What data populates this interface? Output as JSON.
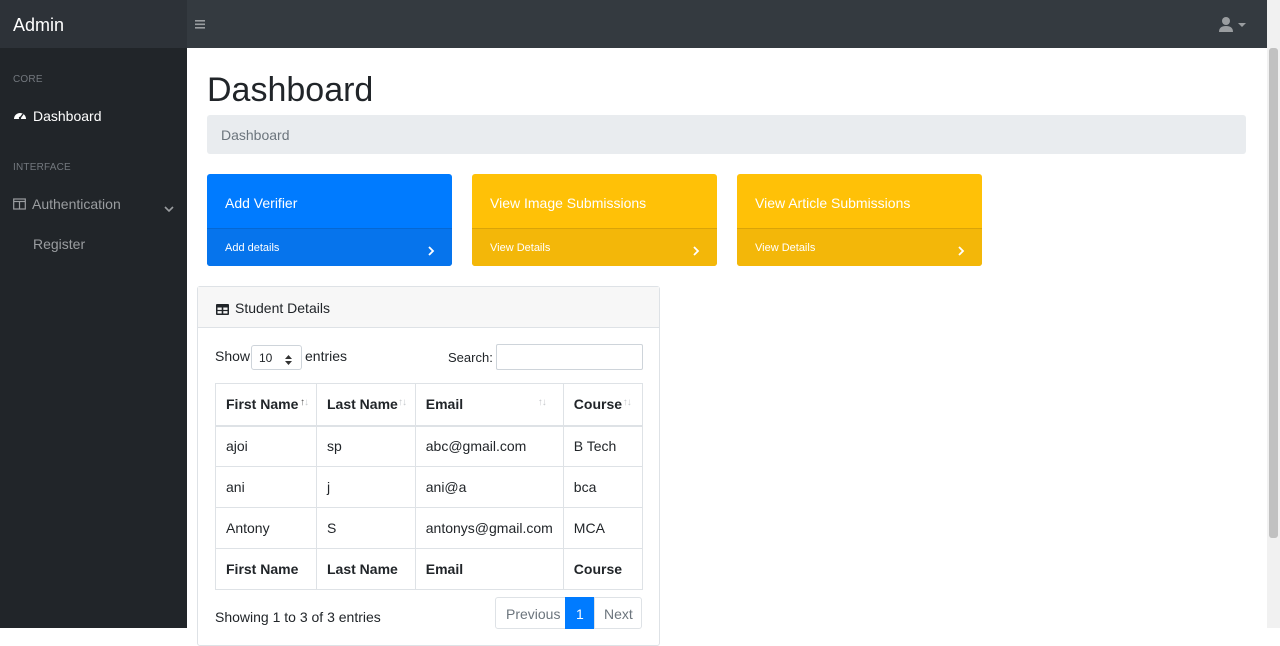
{
  "topnav": {
    "brand": "Admin"
  },
  "sidebar": {
    "heading_core": "CORE",
    "dashboard_label": "Dashboard",
    "heading_interface": "INTERFACE",
    "authentication_label": "Authentication",
    "register_label": "Register"
  },
  "main": {
    "title": "Dashboard",
    "breadcrumb": "Dashboard"
  },
  "cards": [
    {
      "title": "Add Verifier",
      "footer": "Add details",
      "color": "#007bff"
    },
    {
      "title": "View Image Submissions",
      "footer": "View Details",
      "color": "#ffc107"
    },
    {
      "title": "View Article Submissions",
      "footer": "View Details",
      "color": "#ffc107"
    }
  ],
  "table_panel": {
    "title": "Student Details",
    "show_label": "Show",
    "page_length": "10",
    "entries_label": "entries",
    "search_label": "Search:",
    "search_value": "",
    "columns": [
      "First Name",
      "Last Name",
      "Email",
      "Course"
    ],
    "rows": [
      [
        "ajoi",
        "sp",
        "abc@gmail.com",
        "B Tech"
      ],
      [
        "ani",
        "j",
        "ani@a",
        "bca"
      ],
      [
        "Antony",
        "S",
        "antonys@gmail.com",
        "MCA"
      ]
    ],
    "info": "Showing 1 to 3 of 3 entries",
    "pagination": {
      "previous": "Previous",
      "current_page": "1",
      "next": "Next"
    }
  },
  "colors": {
    "accent": "#007bff",
    "warning": "#ffc107",
    "nav_bg": "#343a40",
    "sidebar_bg": "#212529"
  }
}
